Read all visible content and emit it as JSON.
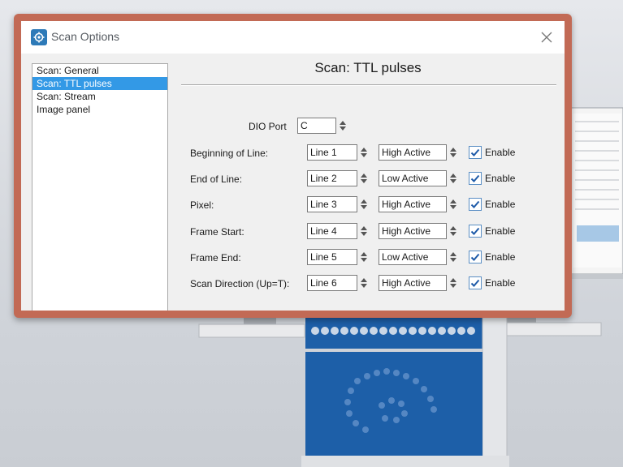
{
  "window": {
    "title": "Scan Options",
    "app_icon": "gear-app-icon",
    "close_icon": "close-icon"
  },
  "sidebar": {
    "items": [
      {
        "label": "Scan: General",
        "selected": false
      },
      {
        "label": "Scan: TTL pulses",
        "selected": true
      },
      {
        "label": "Scan: Stream",
        "selected": false
      },
      {
        "label": "Image panel",
        "selected": false
      }
    ]
  },
  "panel": {
    "title": "Scan: TTL pulses",
    "dio_port": {
      "label": "DIO Port",
      "value": "C"
    },
    "rows": [
      {
        "label": "Beginning of Line:",
        "line": "Line 1",
        "polarity": "High Active",
        "enable_label": "Enable",
        "enabled": true
      },
      {
        "label": "End of Line:",
        "line": "Line 2",
        "polarity": "Low Active",
        "enable_label": "Enable",
        "enabled": true
      },
      {
        "label": "Pixel:",
        "line": "Line 3",
        "polarity": "High Active",
        "enable_label": "Enable",
        "enabled": true
      },
      {
        "label": "Frame Start:",
        "line": "Line 4",
        "polarity": "High Active",
        "enable_label": "Enable",
        "enabled": true
      },
      {
        "label": "Frame End:",
        "line": "Line 5",
        "polarity": "Low Active",
        "enable_label": "Enable",
        "enabled": true
      },
      {
        "label": "Scan Direction (Up=T):",
        "line": "Line 6",
        "polarity": "High Active",
        "enable_label": "Enable",
        "enabled": true
      }
    ]
  },
  "colors": {
    "frame_border": "#c26a55",
    "selection": "#3399e6",
    "checkbox_border": "#5a8ec4",
    "device_blue": "#1d5fa8"
  }
}
